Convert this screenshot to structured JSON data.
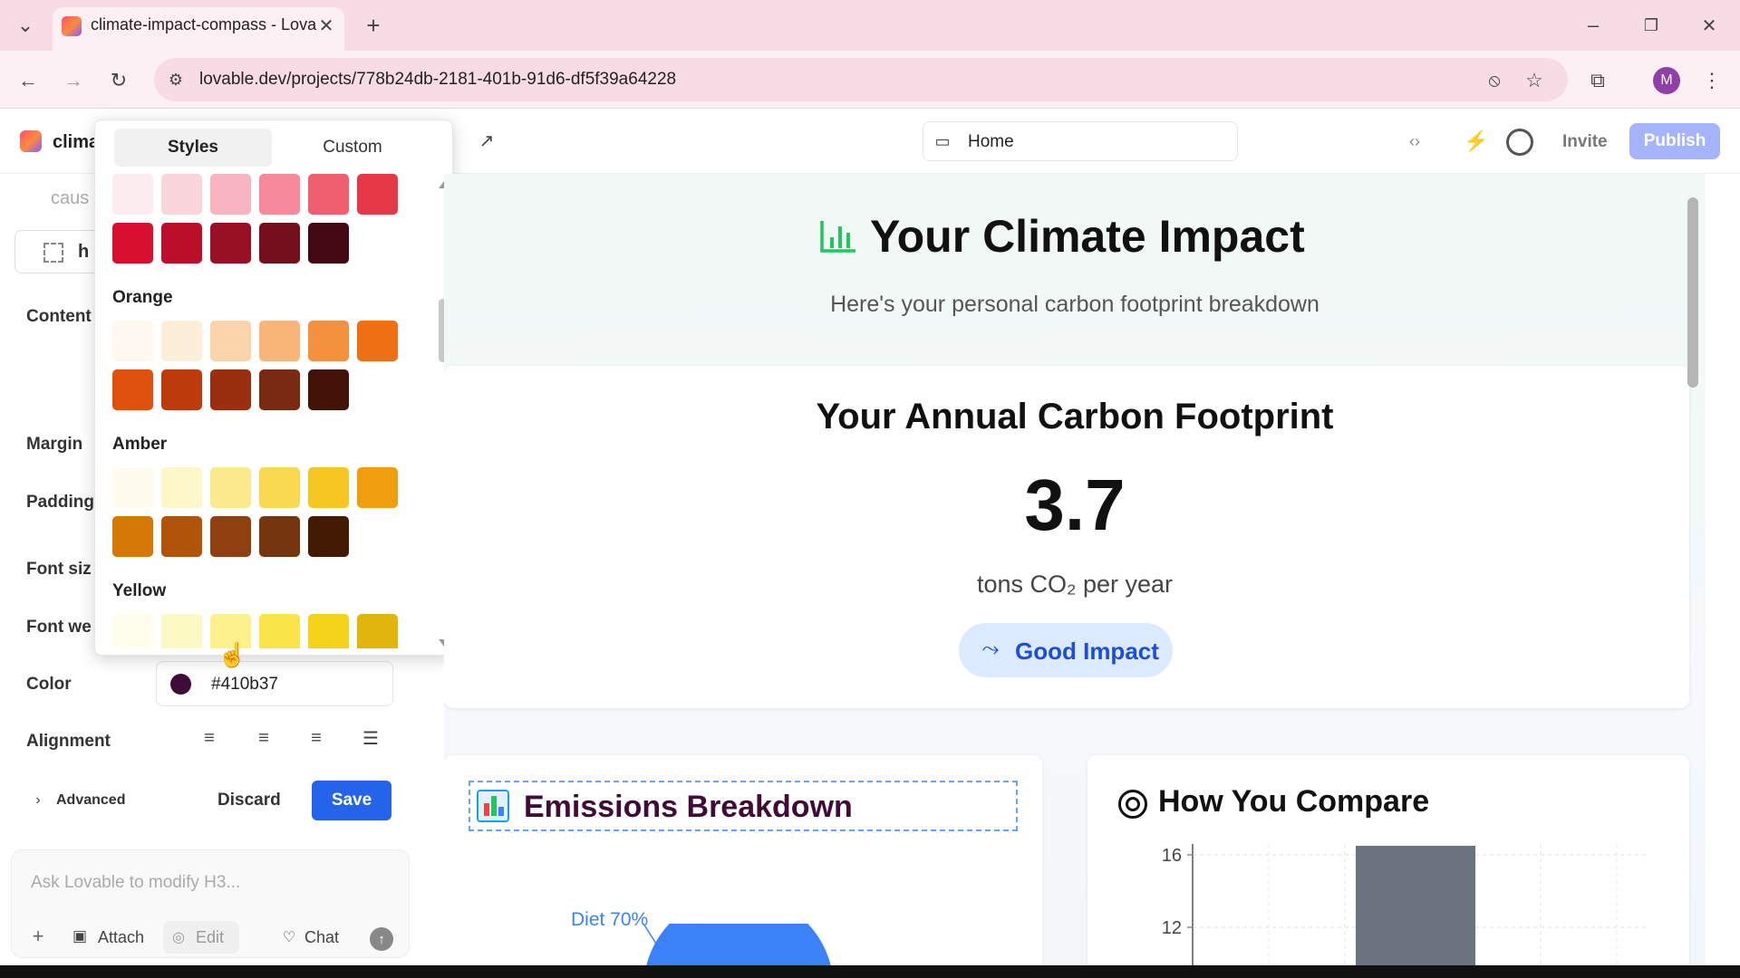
{
  "browser": {
    "tab_title": "climate-impact-compass - Lova",
    "url": "lovable.dev/projects/778b24db-2181-401b-91d6-df5f39a64228",
    "profile_initial": "M"
  },
  "app_header": {
    "project_name_fragment": "clima",
    "route_label": "Home",
    "invite_label": "Invite",
    "publish_label": "Publish"
  },
  "style_popover": {
    "tabs": [
      "Styles",
      "Custom"
    ],
    "active_tab": "Styles",
    "groups": [
      {
        "name": "",
        "rows": [
          [
            "#fdecef",
            "#fbd5dc",
            "#f8b4c0",
            "#f48a9c",
            "#ee6070",
            "#e63948"
          ],
          [
            "#d6102e",
            "#bb0e28",
            "#971023",
            "#74101e",
            "#420914"
          ]
        ]
      },
      {
        "name": "Orange",
        "rows": [
          [
            "#fff8f0",
            "#fdeed9",
            "#fbd4ac",
            "#f9b577",
            "#f4913f",
            "#ee6f14"
          ],
          [
            "#df4f0d",
            "#bc3a0c",
            "#983010",
            "#792a11",
            "#431307"
          ]
        ]
      },
      {
        "name": "Amber",
        "rows": [
          [
            "#fffcef",
            "#fdf6c8",
            "#fbea8d",
            "#f9d950",
            "#f6c623",
            "#f09e10"
          ],
          [
            "#d67807",
            "#b1540a",
            "#90400e",
            "#74350f",
            "#441a05"
          ]
        ]
      },
      {
        "name": "Yellow",
        "rows": [
          [
            "#fffdeb",
            "#fdf9c2",
            "#fcf08b",
            "#f9e549",
            "#f5d31a",
            "#e2b50c"
          ]
        ]
      }
    ]
  },
  "left_panel": {
    "top_text_fragment": "caus",
    "element_tag_fragment": "h",
    "labels": {
      "content": "Content",
      "margin": "Margin",
      "padding": "Padding",
      "font_size": "Font siz",
      "font_weight": "Font we",
      "color": "Color",
      "alignment": "Alignment"
    },
    "color_value": "#410b37",
    "color_swatch": "#410b37",
    "advanced_label": "Advanced",
    "discard_label": "Discard",
    "save_label": "Save",
    "prompt_placeholder": "Ask Lovable to modify H3...",
    "attach_label": "Attach",
    "edit_label": "Edit",
    "chat_label": "Chat"
  },
  "preview": {
    "hero_title": "Your Climate Impact",
    "hero_subtitle": "Here's your personal carbon footprint breakdown",
    "footprint_title": "Your Annual Carbon Footprint",
    "footprint_value": "3.7",
    "footprint_unit": "tons CO₂ per year",
    "impact_badge": "Good Impact",
    "emissions_title": "Emissions Breakdown",
    "emissions_slice_label": "Diet 70%",
    "compare_title": "How You Compare",
    "compare_ticks": [
      "16",
      "12"
    ]
  },
  "colors": {
    "accent": "#2563eb",
    "publish_bg": "#a5b4fc",
    "hero_icon": "#22c55e",
    "pie_blue": "#3b82f6",
    "bar_gray": "#6b7280"
  }
}
